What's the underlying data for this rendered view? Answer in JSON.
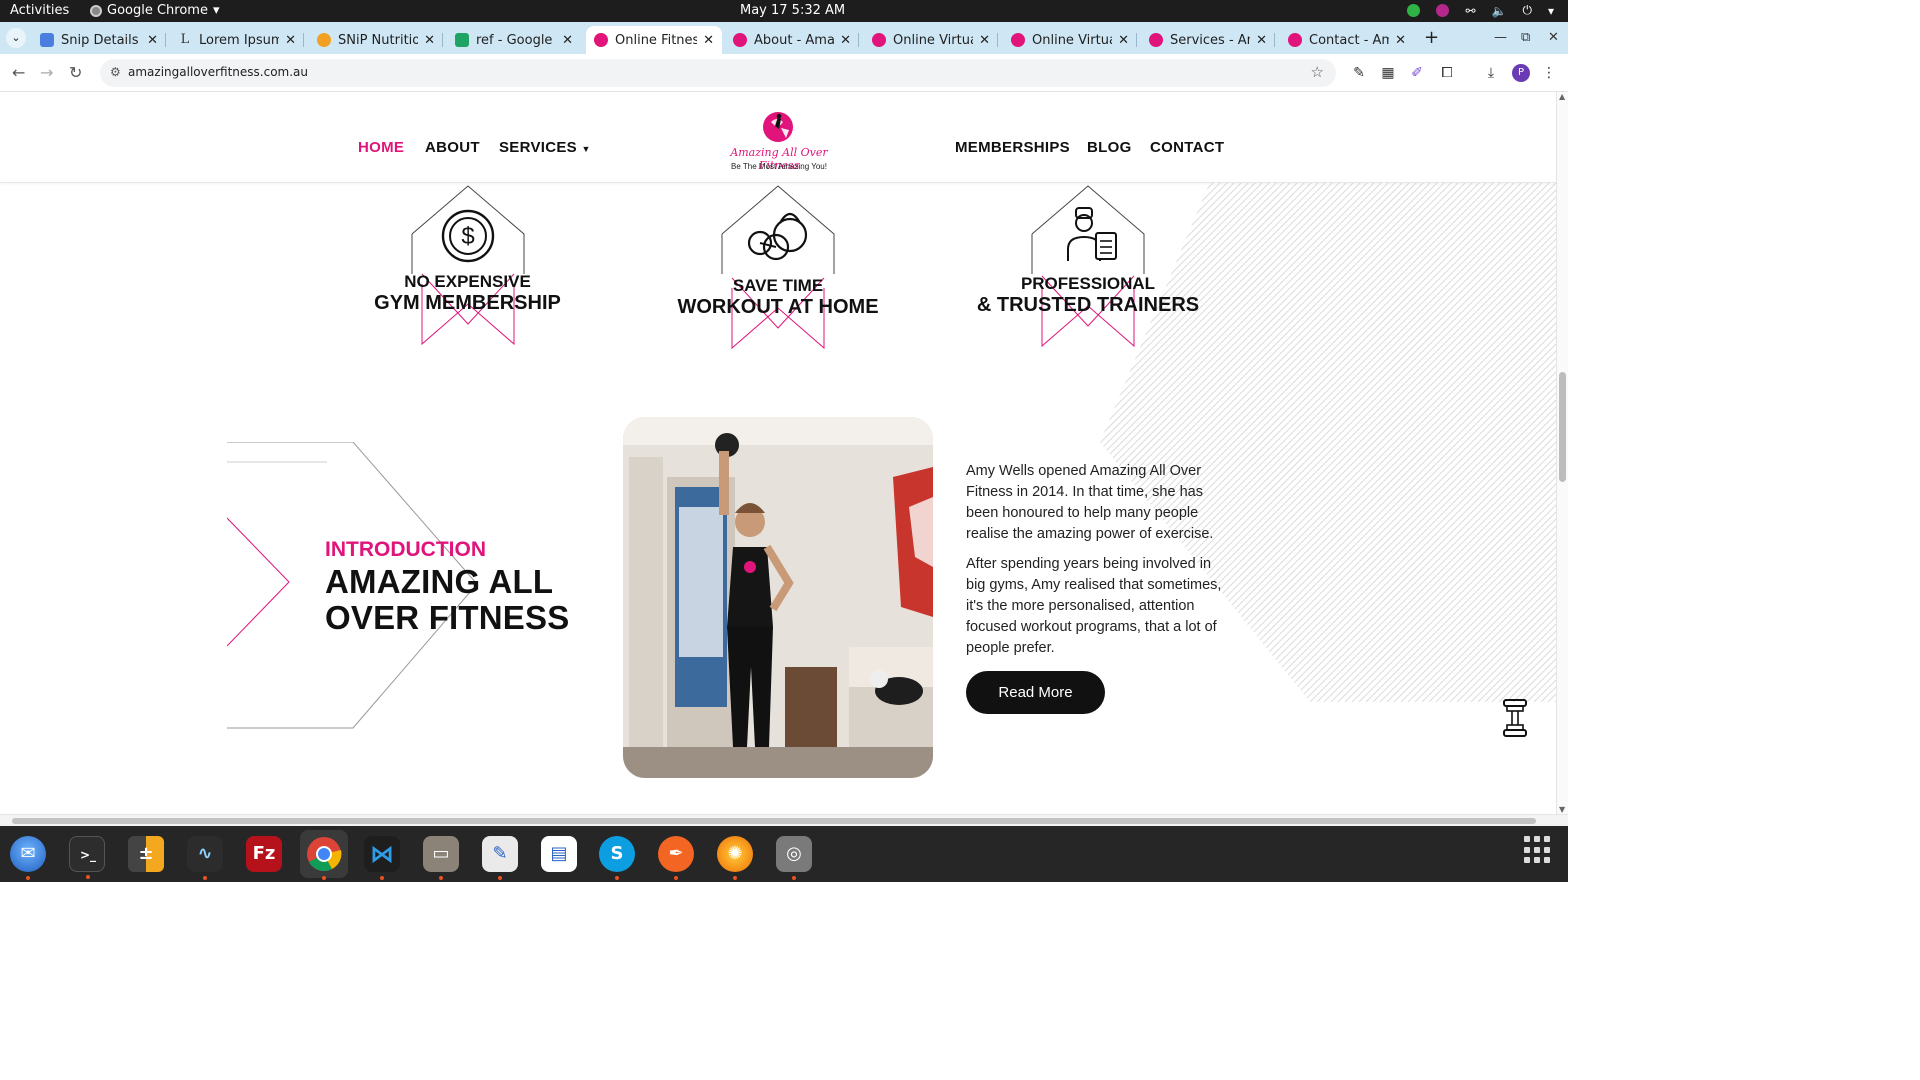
{
  "system": {
    "activities": "Activities",
    "app_name": "Google Chrome",
    "clock": "May 17  5:32 AM"
  },
  "browser": {
    "tabs": [
      {
        "label": "Snip Details - C",
        "icon": "doc-icon",
        "active": false
      },
      {
        "label": "Lorem Ipsum -",
        "icon": "lorem-icon",
        "active": false
      },
      {
        "label": "SNiP Nutrition",
        "icon": "snip-icon",
        "active": false
      },
      {
        "label": "ref - Google Sh",
        "icon": "sheets-icon",
        "active": false
      },
      {
        "label": "Online Fitness",
        "icon": "amazing-icon",
        "active": true
      },
      {
        "label": "About - Amazi",
        "icon": "amazing-icon",
        "active": false
      },
      {
        "label": "Online Virtual",
        "icon": "amazing-icon",
        "active": false
      },
      {
        "label": "Online Virtual",
        "icon": "amazing-icon",
        "active": false
      },
      {
        "label": "Services - Ama",
        "icon": "amazing-icon",
        "active": false
      },
      {
        "label": "Contact - Ama",
        "icon": "amazing-icon",
        "active": false
      }
    ],
    "url": "amazingalloverfitness.com.au",
    "profile_initial": "P"
  },
  "site": {
    "nav_left": [
      {
        "label": "HOME",
        "active": true
      },
      {
        "label": "ABOUT",
        "active": false
      },
      {
        "label": "SERVICES",
        "active": false
      }
    ],
    "nav_right": [
      {
        "label": "MEMBERSHIPS"
      },
      {
        "label": "BLOG"
      },
      {
        "label": "CONTACT"
      }
    ],
    "logo": {
      "name": "Amazing All Over Fitness",
      "tagline": "Be The Most Amazing You!"
    },
    "features": [
      {
        "line1": "NO EXPENSIVE",
        "line2": "GYM MEMBERSHIP",
        "icon": "dollar-coin-icon"
      },
      {
        "line1": "SAVE TIME",
        "line2": "WORKOUT AT HOME",
        "icon": "kettlebell-icon"
      },
      {
        "line1": "PROFESSIONAL",
        "line2": "& TRUSTED TRAINERS",
        "icon": "trainer-icon"
      }
    ],
    "intro": {
      "kicker": "INTRODUCTION",
      "title": "AMAZING ALL OVER FITNESS",
      "paragraph1": "Amy Wells opened Amazing All Over Fitness in 2014. In that time, she has been honoured to help many people realise the amazing power of exercise.",
      "paragraph2": "After spending years being involved in big gyms, Amy realised that sometimes, it's the more personalised, attention focused workout programs, that a lot of people prefer.",
      "cta": "Read More"
    }
  },
  "colors": {
    "brand_pink": "#e0147a",
    "text_dark": "#111111",
    "tab_strip": "#cfe7f5"
  },
  "dock": [
    {
      "name": "thunderbird"
    },
    {
      "name": "terminal",
      "glyph": ">_"
    },
    {
      "name": "calculator"
    },
    {
      "name": "system-monitor"
    },
    {
      "name": "filezilla",
      "glyph": "Fz"
    },
    {
      "name": "chrome"
    },
    {
      "name": "vscode"
    },
    {
      "name": "files"
    },
    {
      "name": "text-editor"
    },
    {
      "name": "libreoffice-writer"
    },
    {
      "name": "skype",
      "glyph": "S"
    },
    {
      "name": "inkscape-pen"
    },
    {
      "name": "firefox-dev"
    },
    {
      "name": "disk-utility"
    }
  ]
}
